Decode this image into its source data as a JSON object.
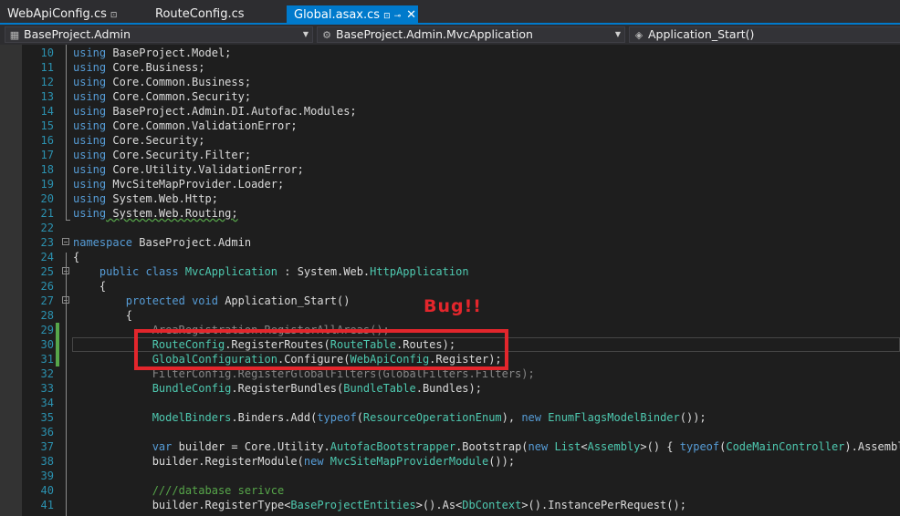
{
  "tabs": [
    {
      "label": "WebApiConfig.cs",
      "pin": "⊡"
    },
    {
      "label": "RouteConfig.cs",
      "pin": ""
    },
    {
      "label": "Global.asax.cs",
      "pin": "⊡",
      "pin2": "⊸",
      "close": "✕"
    }
  ],
  "nav": {
    "project": "BaseProject.Admin",
    "class": "BaseProject.Admin.MvcApplication",
    "member": "Application_Start()"
  },
  "annotation": "Bug!!",
  "lines": {
    "l10": {
      "n": "10",
      "kw": "using",
      "rest": " BaseProject.Model;"
    },
    "l11": {
      "n": "11",
      "kw": "using",
      "rest": " Core.Business;"
    },
    "l12": {
      "n": "12",
      "kw": "using",
      "rest": " Core.Common.Business;"
    },
    "l13": {
      "n": "13",
      "kw": "using",
      "rest": " Core.Common.Security;"
    },
    "l14": {
      "n": "14",
      "kw": "using",
      "rest": " BaseProject.Admin.DI.Autofac.Modules;"
    },
    "l15": {
      "n": "15",
      "kw": "using",
      "rest": " Core.Common.ValidationError;"
    },
    "l16": {
      "n": "16",
      "kw": "using",
      "rest": " Core.Security;"
    },
    "l17": {
      "n": "17",
      "kw": "using",
      "rest": " Core.Security.Filter;"
    },
    "l18": {
      "n": "18",
      "kw": "using",
      "rest": " Core.Utility.ValidationError;"
    },
    "l19": {
      "n": "19",
      "kw": "using",
      "rest": " MvcSiteMapProvider.Loader;"
    },
    "l20": {
      "n": "20",
      "kw": "using",
      "rest": " System.Web.Http;"
    },
    "l21": {
      "n": "21",
      "kw": "using",
      "rest": " System.Web.Routing;"
    },
    "l22": {
      "n": "22"
    },
    "l23": {
      "n": "23",
      "kw": "namespace",
      "rest": " BaseProject.Admin"
    },
    "l24": {
      "n": "24",
      "text": "{"
    },
    "l25": {
      "n": "25",
      "a": "    ",
      "kw1": "public",
      "s1": " ",
      "kw2": "class",
      "s2": " ",
      "type": "MvcApplication",
      "s3": " : System.Web.",
      "type2": "HttpApplication"
    },
    "l26": {
      "n": "26",
      "text": "    {"
    },
    "l27": {
      "n": "27",
      "a": "        ",
      "kw1": "protected",
      "s1": " ",
      "kw2": "void",
      "rest": " Application_Start()"
    },
    "l28": {
      "n": "28",
      "text": "        {"
    },
    "l29": {
      "n": "29",
      "text": "            AreaRegistration.RegisterAllAreas();"
    },
    "l30": {
      "n": "30",
      "a": "            ",
      "t1": "RouteConfig",
      "m1": ".RegisterRoutes(",
      "t2": "RouteTable",
      "m2": ".Routes);"
    },
    "l31": {
      "n": "31",
      "a": "            ",
      "t1": "GlobalConfiguration",
      "m1": ".Configure(",
      "t2": "WebApiConfig",
      "m2": ".Register);"
    },
    "l32": {
      "n": "32",
      "text": "            FilterConfig.RegisterGlobalFilters(GlobalFilters.Filters);"
    },
    "l33": {
      "n": "33",
      "a": "            ",
      "t1": "BundleConfig",
      "m1": ".RegisterBundles(",
      "t2": "BundleTable",
      "m2": ".Bundles);"
    },
    "l34": {
      "n": "34"
    },
    "l35": {
      "n": "35",
      "a": "            ",
      "t1": "ModelBinders",
      "m1": ".Binders.Add(",
      "k1": "typeof",
      "m2": "(",
      "t2": "ResourceOperationEnum",
      "m3": "), ",
      "k2": "new",
      "m4": " ",
      "t3": "EnumFlagsModelBinder",
      "m5": "());"
    },
    "l36": {
      "n": "36"
    },
    "l37": {
      "n": "37",
      "a": "            ",
      "k1": "var",
      "m1": " builder = Core.Utility.",
      "t1": "AutofacBootstrapper",
      "m2": ".Bootstrap(",
      "k2": "new",
      "m3": " ",
      "t2": "List",
      "m4": "<",
      "t3": "Assembly",
      "m5": ">() { ",
      "k3": "typeof",
      "m6": "(",
      "t4": "CodeMainController",
      "m7": ").Assembly }"
    },
    "l38": {
      "n": "38",
      "a": "            ",
      "m1": "builder.RegisterModule(",
      "k1": "new",
      "m2": " ",
      "t1": "MvcSiteMapProviderModule",
      "m3": "());"
    },
    "l39": {
      "n": "39"
    },
    "l40": {
      "n": "40",
      "a": "            ",
      "c": "////database serivce"
    },
    "l41": {
      "n": "41",
      "a": "            ",
      "m1": "builder.RegisterType<",
      "t1": "BaseProjectEntities",
      "m2": ">().As<",
      "t2": "DbContext",
      "m3": ">().InstancePerRequest();"
    }
  },
  "colors": {
    "accent": "#007acc",
    "keyword": "#569cd6",
    "type": "#4ec9b0",
    "comment": "#57a64a",
    "annotation": "#e3262c"
  }
}
